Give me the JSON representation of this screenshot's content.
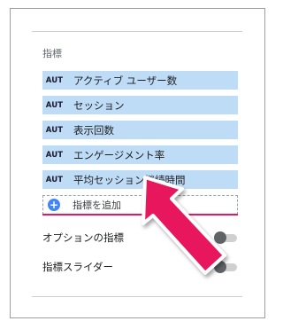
{
  "panel": {
    "section_title": "指標",
    "metrics": [
      {
        "badge": "AUT",
        "label": "アクティブ ユーザー数"
      },
      {
        "badge": "AUT",
        "label": "セッション"
      },
      {
        "badge": "AUT",
        "label": "表示回数"
      },
      {
        "badge": "AUT",
        "label": "エンゲージメント率"
      },
      {
        "badge": "AUT",
        "label": "平均セッション継続時間"
      }
    ],
    "add_metric_label": "指標を追加",
    "optional_metrics_label": "オプションの指標",
    "metric_slider_label": "指標スライダー",
    "optional_metrics_on": false,
    "metric_slider_on": false
  },
  "colors": {
    "metric_bg": "#bfdcf7",
    "accent_blue": "#4285f4",
    "arrow_pink": "#e8175d"
  },
  "icons": {
    "add": "plus-circle-icon",
    "annotation": "pointer-arrow-icon"
  }
}
